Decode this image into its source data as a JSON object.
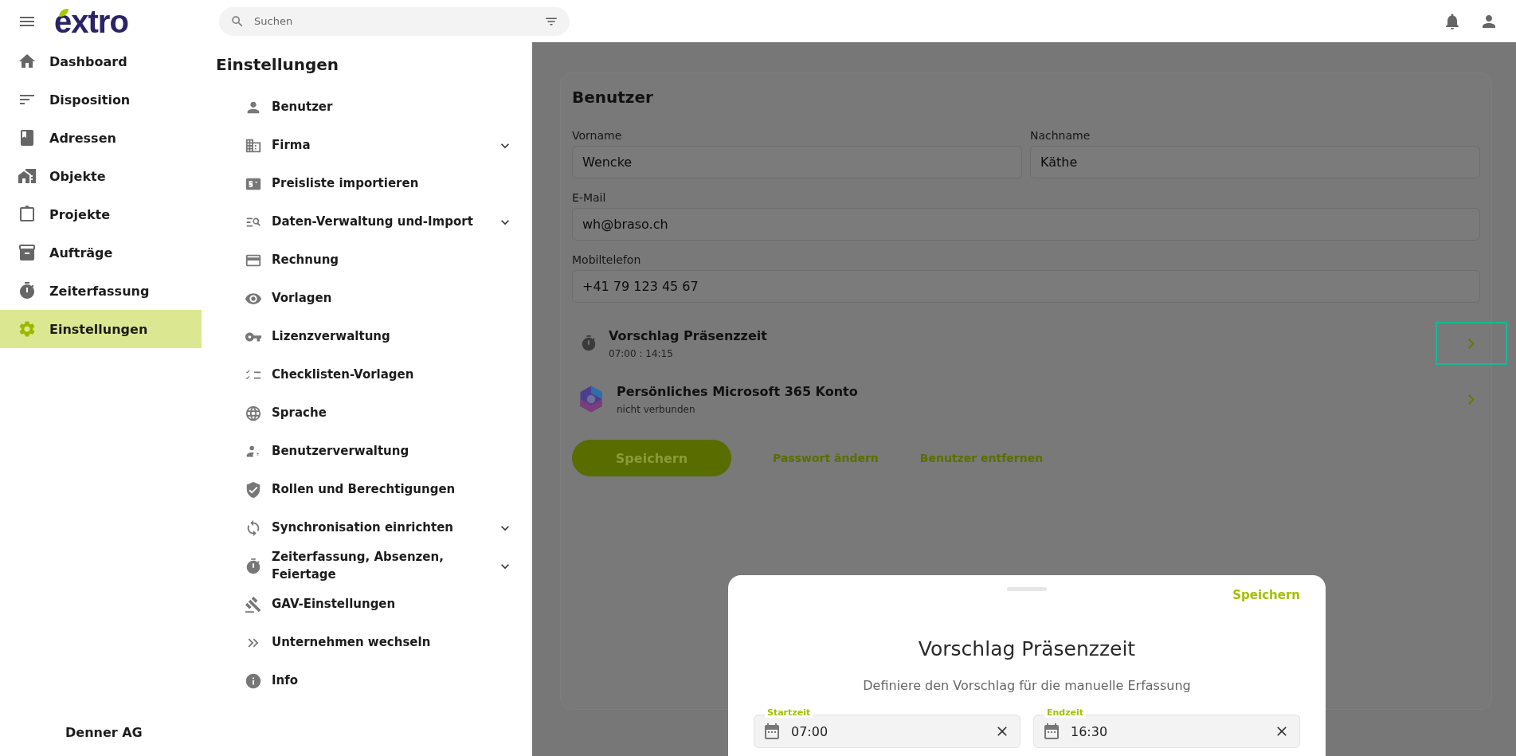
{
  "header": {
    "logo": "extro",
    "search_placeholder": "Suchen"
  },
  "nav": {
    "items": [
      {
        "label": "Dashboard",
        "selected": false
      },
      {
        "label": "Disposition",
        "selected": false
      },
      {
        "label": "Adressen",
        "selected": false
      },
      {
        "label": "Objekte",
        "selected": false
      },
      {
        "label": "Projekte",
        "selected": false
      },
      {
        "label": "Aufträge",
        "selected": false
      },
      {
        "label": "Zeiterfassung",
        "selected": false
      },
      {
        "label": "Einstellungen",
        "selected": true
      }
    ],
    "company": "Denner AG"
  },
  "settings": {
    "title": "Einstellungen",
    "items": [
      {
        "label": "Benutzer",
        "expandable": false
      },
      {
        "label": "Firma",
        "expandable": true
      },
      {
        "label": "Preisliste importieren",
        "expandable": false
      },
      {
        "label": "Daten-Verwaltung und-Import",
        "expandable": true
      },
      {
        "label": "Rechnung",
        "expandable": false
      },
      {
        "label": "Vorlagen",
        "expandable": false
      },
      {
        "label": "Lizenzverwaltung",
        "expandable": false
      },
      {
        "label": "Checklisten-Vorlagen",
        "expandable": false
      },
      {
        "label": "Sprache",
        "expandable": false
      },
      {
        "label": "Benutzerverwaltung",
        "expandable": false
      },
      {
        "label": "Rollen und Berechtigungen",
        "expandable": false
      },
      {
        "label": "Synchronisation einrichten",
        "expandable": true
      },
      {
        "label": "Zeiterfassung, Absenzen, Feiertage",
        "expandable": true
      },
      {
        "label": "GAV-Einstellungen",
        "expandable": false
      },
      {
        "label": "Unternehmen wechseln",
        "expandable": false
      },
      {
        "label": "Info",
        "expandable": false
      }
    ]
  },
  "profile": {
    "title": "Benutzer",
    "field_rows": [
      [
        {
          "label": "Vorname",
          "value": "Wencke"
        },
        {
          "label": "Nachname",
          "value": "Käthe"
        }
      ],
      [
        {
          "label": "E-Mail",
          "value": "wh@braso.ch"
        }
      ],
      [
        {
          "label": "Mobiltelefon",
          "value": "+41 79 123 45 67"
        }
      ]
    ],
    "rows": [
      {
        "kind": "timer",
        "title": "Vorschlag Präsenzzeit",
        "subtitle": "07:00 : 14:15",
        "focused": true
      },
      {
        "kind": "account",
        "title": "Persönliches Microsoft 365 Konto",
        "subtitle": "nicht verbunden",
        "focused": false
      }
    ],
    "save_button": "Speichern",
    "links": [
      "Passwort ändern",
      "Benutzer entfernen"
    ]
  },
  "sheet": {
    "save": "Speichern",
    "title": "Vorschlag Präsenzzeit",
    "subtitle": "Definiere den Vorschlag für die manuelle Erfassung",
    "fields": [
      {
        "label": "Startzeit",
        "value": "07:00"
      },
      {
        "label": "Endzeit",
        "value": "16:30"
      }
    ]
  }
}
